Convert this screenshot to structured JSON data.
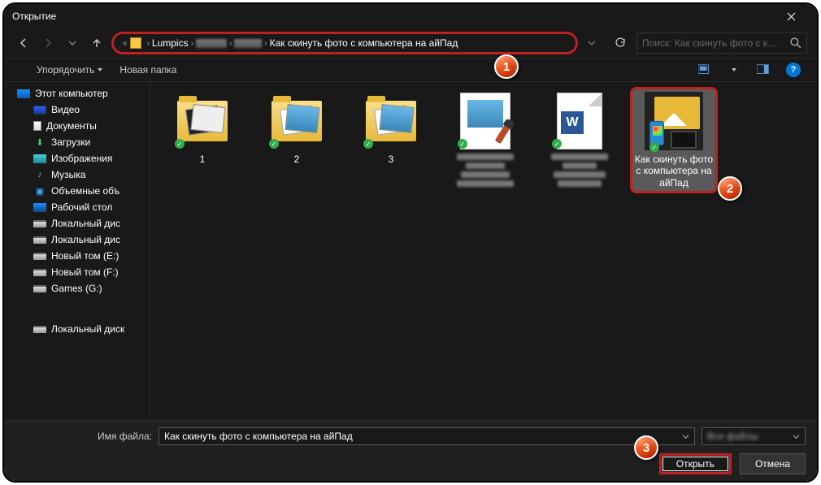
{
  "window": {
    "title": "Открытие"
  },
  "nav": {
    "breadcrumb": {
      "seg1": "Lumpics",
      "seg2": "Как скинуть фото с компьютера на айПад"
    },
    "search_placeholder": "Поиск: Как скинуть фото с к..."
  },
  "toolbar": {
    "organize": "Упорядочить",
    "new_folder": "Новая папка"
  },
  "sidebar": {
    "root": "Этот компьютер",
    "items": [
      "Видео",
      "Документы",
      "Загрузки",
      "Изображения",
      "Музыка",
      "Объемные объ",
      "Рабочий стол",
      "Локальный дис",
      "Локальный дис",
      "Новый том (E:)",
      "Новый том (F:)",
      "Games (G:)",
      "Локальный диск"
    ]
  },
  "files": {
    "f1": "1",
    "f2": "2",
    "f3": "3",
    "selected": "Как скинуть фото с компьютера на айПад"
  },
  "bottom": {
    "filename_label": "Имя файла:",
    "filename_value": "Как скинуть фото с компьютера на айПад",
    "filter": "Все файлы",
    "open": "Открыть",
    "cancel": "Отмена"
  },
  "callouts": {
    "c1": "1",
    "c2": "2",
    "c3": "3"
  }
}
